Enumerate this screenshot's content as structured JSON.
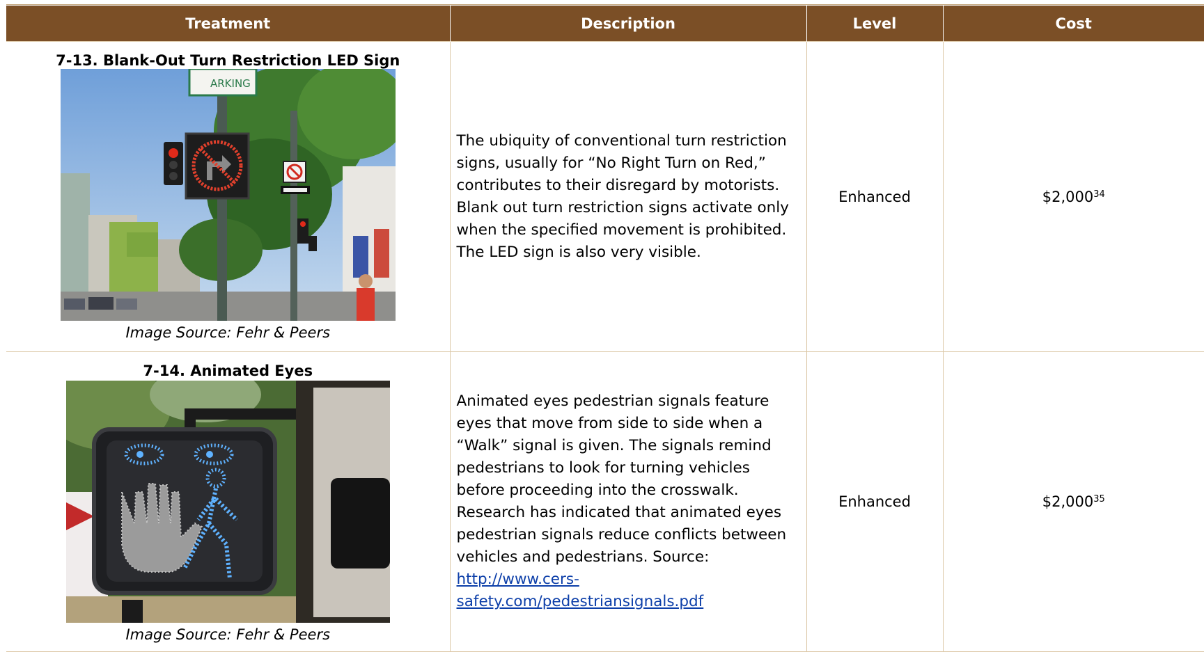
{
  "table": {
    "headers": {
      "treatment": "Treatment",
      "description": "Description",
      "level": "Level",
      "cost": "Cost"
    },
    "rows": [
      {
        "title": "7-13. Blank-Out Turn Restriction LED Sign",
        "image_credit": "Image Source: Fehr & Peers",
        "image_sign_text": "ARKING",
        "description": "The ubiquity of conventional turn restriction signs, usually for “No Right Turn on Red,” contributes to their disregard by motorists. Blank out turn restriction signs activate only when the specified movement is prohibited. The LED sign is also very visible.",
        "level": "Enhanced",
        "cost": "$2,000",
        "cost_footnote": "34"
      },
      {
        "title": "7-14. Animated Eyes",
        "image_credit": "Image Source: Fehr & Peers",
        "description": "Animated eyes pedestrian signals feature eyes that move from side to side when a “Walk” signal is given. The signals remind pedestrians to look for turning vehicles before proceeding into the crosswalk. Research has indicated that animated eyes pedestrian signals reduce conflicts between vehicles and pedestrians. Source: ",
        "link_text": "http://www.cers-safety.com/pedestriansignals.pdf",
        "level": "Enhanced",
        "cost": "$2,000",
        "cost_footnote": "35"
      }
    ]
  },
  "colors": {
    "header_bg": "#7b4f26",
    "grid_border": "#dcc7a6",
    "link": "#0d3fa9"
  }
}
